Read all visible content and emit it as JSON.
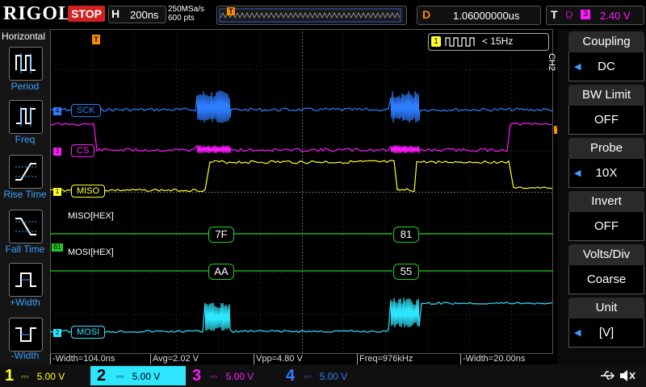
{
  "brand": "RIGOL",
  "run_state": "STOP",
  "timebase": {
    "label": "H",
    "value": "200ns"
  },
  "sample": {
    "rate": "250MSa/s",
    "points": "600 pts"
  },
  "trigger_marker": "T",
  "delay": {
    "label": "D",
    "value": "1.06000000us"
  },
  "trigger": {
    "label": "T",
    "source": "3",
    "level": "2.40 V"
  },
  "horizontal_menu": {
    "title": "Horizontal",
    "items": [
      "Period",
      "Freq",
      "Rise Time",
      "Fall Time",
      "+Width",
      "-Width"
    ]
  },
  "counter": {
    "channel": "1",
    "value": "< 15Hz"
  },
  "right_menu": {
    "channel_tag": "CH2",
    "items": [
      {
        "label": "Coupling",
        "value": "DC"
      },
      {
        "label": "BW Limit",
        "value": "OFF"
      },
      {
        "label": "Probe",
        "value": "10X"
      },
      {
        "label": "Invert",
        "value": "OFF"
      },
      {
        "label": "Volts/Div",
        "value": "Coarse"
      },
      {
        "label": "Unit",
        "value": "[V]"
      }
    ]
  },
  "traces": {
    "sck": {
      "num": "4",
      "label": "SCK",
      "color": "#2e7dff"
    },
    "cs": {
      "num": "3",
      "label": "CS",
      "color": "#ff1aff"
    },
    "miso": {
      "num": "1",
      "label": "MISO",
      "color": "#ffff2a"
    },
    "mosi": {
      "num": "2",
      "label": "MOSI",
      "color": "#2ee6ff"
    }
  },
  "decode": {
    "miso": {
      "title": "MISO[HEX]",
      "tag": "B1",
      "values": [
        "7F",
        "81"
      ]
    },
    "mosi": {
      "title": "MOSI[HEX]",
      "values": [
        "AA",
        "55"
      ]
    },
    "color": "#22cc22"
  },
  "measurements": [
    "-Width=104.0ns",
    "Avg=2.02 V",
    "Vpp=4.80 V",
    "Freq=976kHz",
    "-Width=20.00ns"
  ],
  "channels": [
    {
      "num": "1",
      "scale": "5.00 V",
      "color": "#ffff2a"
    },
    {
      "num": "2",
      "scale": "5.00 V",
      "color": "#2ee6ff"
    },
    {
      "num": "3",
      "scale": "5.00 V",
      "color": "#ff1aff"
    },
    {
      "num": "4",
      "scale": "5.00 V",
      "color": "#2e7dff"
    }
  ]
}
